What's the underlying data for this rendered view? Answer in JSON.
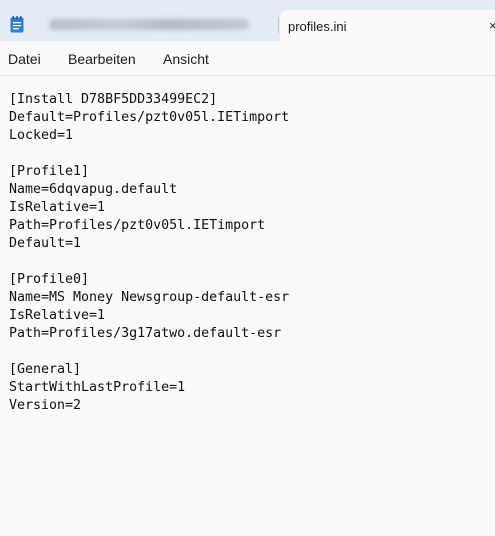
{
  "tabs": {
    "inactive_title": "",
    "active_title": "profiles.ini",
    "close_glyph": "×"
  },
  "menu": {
    "file": "Datei",
    "edit": "Bearbeiten",
    "view": "Ansicht"
  },
  "editor": {
    "lines": [
      "[Install D78BF5DD33499EC2]",
      "Default=Profiles/pzt0v05l.IETimport",
      "Locked=1",
      "",
      "[Profile1]",
      "Name=6dqvapug.default",
      "IsRelative=1",
      "Path=Profiles/pzt0v05l.IETimport",
      "Default=1",
      "",
      "[Profile0]",
      "Name=MS Money Newsgroup-default-esr",
      "IsRelative=1",
      "Path=Profiles/3g17atwo.default-esr",
      "",
      "[General]",
      "StartWithLastProfile=1",
      "Version=2"
    ]
  },
  "icons": {
    "app": "notepad-icon",
    "close": "close-icon"
  },
  "colors": {
    "tabstrip_bg": "#e3ebf4",
    "editor_bg": "#fafafa",
    "app_icon_blue": "#2f7fd6"
  }
}
